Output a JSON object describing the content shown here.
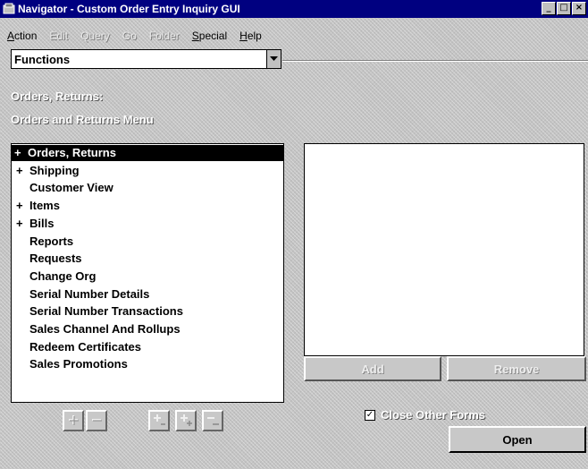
{
  "window": {
    "title": "Navigator - Custom Order Entry Inquiry GUI",
    "controls": [
      "_",
      "□",
      "×"
    ]
  },
  "menubar": [
    {
      "pre": "",
      "ul": "A",
      "post": "ction",
      "enabled": true
    },
    {
      "pre": "",
      "ul": "",
      "post": "Edit",
      "enabled": false
    },
    {
      "pre": "",
      "ul": "",
      "post": "Query",
      "enabled": false
    },
    {
      "pre": "",
      "ul": "",
      "post": "Go",
      "enabled": false
    },
    {
      "pre": "",
      "ul": "",
      "post": "Folder",
      "enabled": false
    },
    {
      "pre": "",
      "ul": "S",
      "post": "pecial",
      "enabled": true
    },
    {
      "pre": "",
      "ul": "H",
      "post": "elp",
      "enabled": true
    }
  ],
  "functions_select": {
    "value": "Functions"
  },
  "context": {
    "line1": "Orders, Returns:",
    "line2": "Orders and Returns Menu"
  },
  "function_list": [
    {
      "prefix": "+",
      "label": "Orders, Returns",
      "selected": true
    },
    {
      "prefix": "+",
      "label": "Shipping",
      "selected": false
    },
    {
      "prefix": "",
      "label": "Customer View",
      "selected": false
    },
    {
      "prefix": "+",
      "label": "Items",
      "selected": false
    },
    {
      "prefix": "+",
      "label": "Bills",
      "selected": false
    },
    {
      "prefix": "",
      "label": "Reports",
      "selected": false
    },
    {
      "prefix": "",
      "label": "Requests",
      "selected": false
    },
    {
      "prefix": "",
      "label": "Change Org",
      "selected": false
    },
    {
      "prefix": "",
      "label": "Serial Number Details",
      "selected": false
    },
    {
      "prefix": "",
      "label": "Serial Number Transactions",
      "selected": false
    },
    {
      "prefix": "",
      "label": "Sales Channel And Rollups",
      "selected": false
    },
    {
      "prefix": "",
      "label": "Redeem Certificates",
      "selected": false
    },
    {
      "prefix": "",
      "label": "Sales Promotions",
      "selected": false
    }
  ],
  "buttons": {
    "add": "Add",
    "remove": "Remove",
    "open": "Open"
  },
  "close_other_forms": {
    "label": "Close Other Forms",
    "checked": true,
    "mark": "✓"
  },
  "tree_tools": [
    "expand-icon",
    "collapse-icon",
    "expand-branch-icon",
    "expand-all-icon",
    "collapse-all-icon"
  ]
}
